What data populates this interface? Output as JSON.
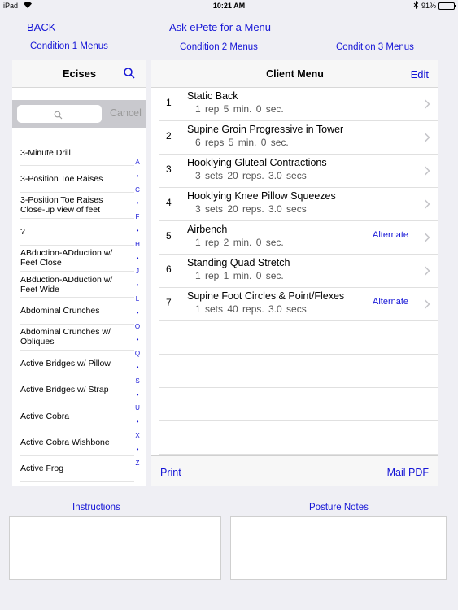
{
  "status_bar": {
    "device": "iPad",
    "time": "10:21 AM",
    "battery": "91%",
    "battery_level": 0.91
  },
  "nav": {
    "back": "BACK",
    "ask": "Ask ePete for a Menu",
    "condition1": "Condition 1 Menus",
    "condition2": "Condition 2 Menus",
    "condition3": "Condition 3 Menus"
  },
  "left_panel": {
    "title": "Ecises",
    "search_placeholder": "",
    "cancel": "Cancel",
    "exercises": [
      "3-Minute Drill",
      "3-Position Toe Raises",
      "3-Position Toe Raises\nClose-up view of feet",
      "?",
      "ABduction-ADduction w/\nFeet Close",
      "ABduction-ADduction w/\nFeet Wide",
      "Abdominal Crunches",
      "Abdominal Crunches w/\nObliques",
      "Active Bridges w/ Pillow",
      "Active Bridges w/ Strap",
      "Active Cobra",
      "Active Cobra Wishbone",
      "Active Frog"
    ],
    "index": [
      "A",
      "•",
      "C",
      "•",
      "F",
      "•",
      "H",
      "•",
      "J",
      "•",
      "L",
      "•",
      "O",
      "•",
      "Q",
      "•",
      "S",
      "•",
      "U",
      "•",
      "X",
      "•",
      "Z"
    ]
  },
  "right_panel": {
    "title": "Client Menu",
    "edit": "Edit",
    "rows": [
      {
        "num": "1",
        "name": "Static Back",
        "detail": "1 rep   5 min.  0 sec.",
        "alternate": ""
      },
      {
        "num": "2",
        "name": "Supine Groin Progressive in Tower",
        "detail": "6 reps   5 min.  0 sec.",
        "alternate": ""
      },
      {
        "num": "3",
        "name": "Hooklying Gluteal Contractions",
        "detail": "3 sets 20 reps. 3.0 secs",
        "alternate": ""
      },
      {
        "num": "4",
        "name": "Hooklying Knee Pillow Squeezes",
        "detail": "3 sets 20 reps. 3.0 secs",
        "alternate": ""
      },
      {
        "num": "5",
        "name": "Airbench",
        "detail": "1 rep    2 min.  0 sec.",
        "alternate": "Alternate"
      },
      {
        "num": "6",
        "name": "Standing Quad Stretch",
        "detail": "1 rep    1 min.  0 sec.",
        "alternate": ""
      },
      {
        "num": "7",
        "name": "Supine Foot Circles & Point/Flexes",
        "detail": "1 sets 40 reps. 3.0 secs",
        "alternate": "Alternate"
      }
    ],
    "print": "Print",
    "mail": "Mail PDF"
  },
  "bottom": {
    "instructions": "Instructions",
    "posture_notes": "Posture Notes"
  }
}
